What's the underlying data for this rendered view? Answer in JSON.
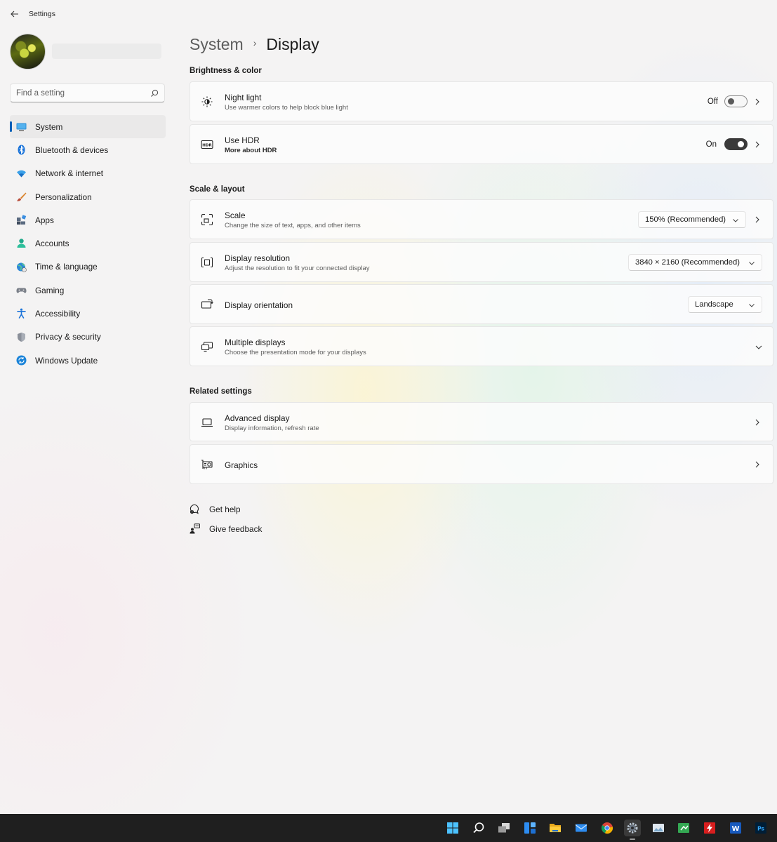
{
  "window": {
    "title": "Settings"
  },
  "search": {
    "placeholder": "Find a setting"
  },
  "sidebar": {
    "items": [
      {
        "label": "System",
        "icon": "system-icon",
        "active": true
      },
      {
        "label": "Bluetooth & devices",
        "icon": "bluetooth-icon"
      },
      {
        "label": "Network & internet",
        "icon": "network-icon"
      },
      {
        "label": "Personalization",
        "icon": "personalization-brush-icon"
      },
      {
        "label": "Apps",
        "icon": "apps-icon"
      },
      {
        "label": "Accounts",
        "icon": "accounts-icon"
      },
      {
        "label": "Time & language",
        "icon": "time-language-icon"
      },
      {
        "label": "Gaming",
        "icon": "gaming-icon"
      },
      {
        "label": "Accessibility",
        "icon": "accessibility-icon"
      },
      {
        "label": "Privacy & security",
        "icon": "shield-icon"
      },
      {
        "label": "Windows Update",
        "icon": "windows-update-icon"
      }
    ]
  },
  "breadcrumb": {
    "parent": "System",
    "current": "Display",
    "separator": "›"
  },
  "sections": {
    "brightness": {
      "title": "Brightness & color",
      "night_light": {
        "title": "Night light",
        "subtitle": "Use warmer colors to help block blue light",
        "state_label": "Off",
        "on": false
      },
      "hdr": {
        "title": "Use HDR",
        "subtitle": "More about HDR",
        "state_label": "On",
        "on": true
      }
    },
    "scale_layout": {
      "title": "Scale & layout",
      "scale": {
        "title": "Scale",
        "subtitle": "Change the size of text, apps, and other items",
        "value": "150% (Recommended)"
      },
      "resolution": {
        "title": "Display resolution",
        "subtitle": "Adjust the resolution to fit your connected display",
        "value": "3840 × 2160 (Recommended)"
      },
      "orientation": {
        "title": "Display orientation",
        "value": "Landscape"
      },
      "multiple": {
        "title": "Multiple displays",
        "subtitle": "Choose the presentation mode for your displays"
      }
    },
    "related": {
      "title": "Related settings",
      "advanced": {
        "title": "Advanced display",
        "subtitle": "Display information, refresh rate"
      },
      "graphics": {
        "title": "Graphics"
      }
    }
  },
  "help": {
    "get_help": "Get help",
    "give_feedback": "Give feedback"
  },
  "colors": {
    "accent": "#005fb8",
    "taskbar": "#1f1f1f",
    "toggle_on": "#3a3a3a"
  },
  "taskbar": {
    "icons": [
      "start-icon",
      "search-icon",
      "task-view-icon",
      "widgets-icon",
      "file-explorer-icon",
      "mail-icon",
      "chrome-icon",
      "settings-icon",
      "photo-viewer-icon",
      "spreadsheet-app-icon",
      "flash-app-icon",
      "word-icon",
      "photoshop-icon"
    ],
    "word_label": "W",
    "photoshop_label": "Ps"
  }
}
